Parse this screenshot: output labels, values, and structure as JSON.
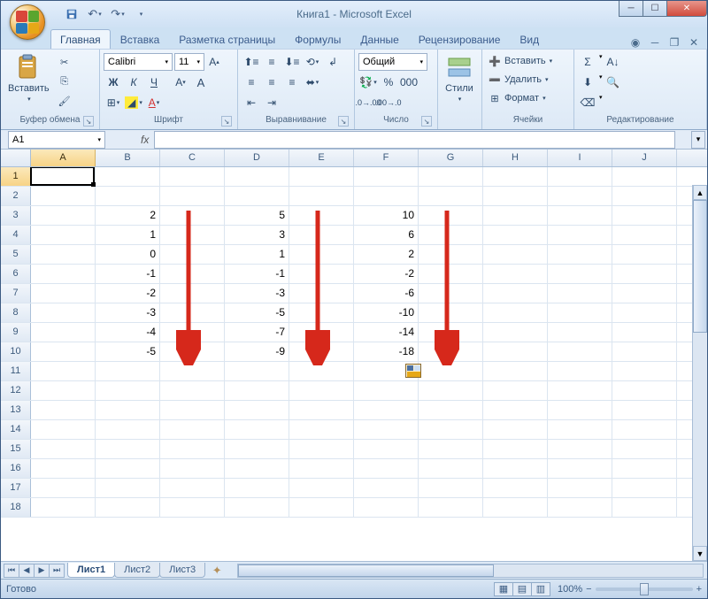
{
  "title": "Книга1 - Microsoft Excel",
  "tabs": {
    "active": "Главная",
    "items": [
      "Главная",
      "Вставка",
      "Разметка страницы",
      "Формулы",
      "Данные",
      "Рецензирование",
      "Вид"
    ]
  },
  "ribbon": {
    "clipboard": {
      "label": "Буфер обмена",
      "paste": "Вставить"
    },
    "font": {
      "label": "Шрифт",
      "name": "Calibri",
      "size": "11",
      "bold": "Ж",
      "italic": "К",
      "underline": "Ч"
    },
    "align": {
      "label": "Выравнивание"
    },
    "number": {
      "label": "Число",
      "format": "Общий",
      "percent": "%",
      "thousand": "000"
    },
    "styles": {
      "label": "",
      "btn": "Стили"
    },
    "cells": {
      "label": "Ячейки",
      "insert": "Вставить",
      "delete": "Удалить",
      "format": "Формат"
    },
    "edit": {
      "label": "Редактирование",
      "sigma": "Σ"
    }
  },
  "name_box": "A1",
  "columns": [
    "A",
    "B",
    "C",
    "D",
    "E",
    "F",
    "G",
    "H",
    "I",
    "J"
  ],
  "active_col": "A",
  "active_row": 1,
  "row_count": 18,
  "cells": {
    "3": {
      "B": "2",
      "D": "5",
      "F": "10"
    },
    "4": {
      "B": "1",
      "D": "3",
      "F": "6"
    },
    "5": {
      "B": "0",
      "D": "1",
      "F": "2"
    },
    "6": {
      "B": "-1",
      "D": "-1",
      "F": "-2"
    },
    "7": {
      "B": "-2",
      "D": "-3",
      "F": "-6"
    },
    "8": {
      "B": "-3",
      "D": "-5",
      "F": "-10"
    },
    "9": {
      "B": "-4",
      "D": "-7",
      "F": "-14"
    },
    "10": {
      "B": "-5",
      "D": "-9",
      "F": "-18"
    }
  },
  "sheets": {
    "active": "Лист1",
    "items": [
      "Лист1",
      "Лист2",
      "Лист3"
    ]
  },
  "status": {
    "ready": "Готово",
    "zoom": "100%"
  }
}
